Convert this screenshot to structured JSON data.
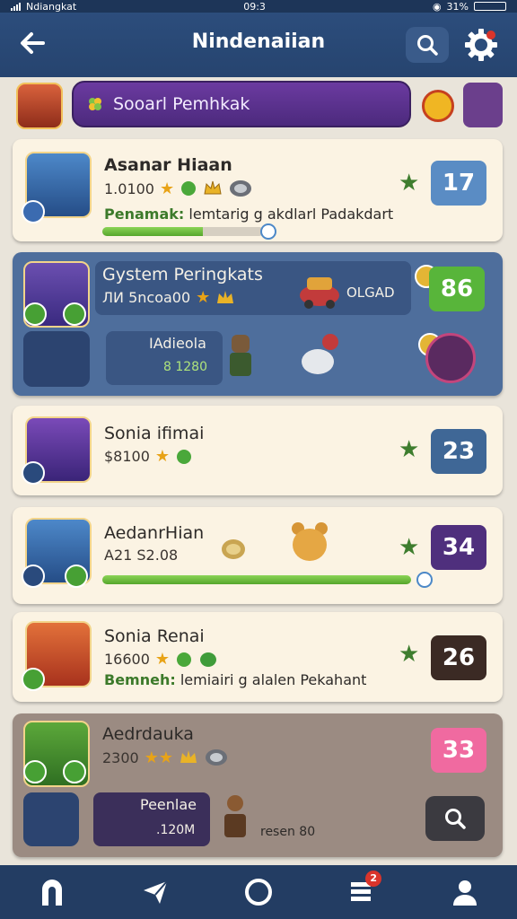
{
  "status_bar": {
    "carrier": "Ndiangkat",
    "time": "09:3",
    "battery": "31%"
  },
  "header": {
    "title": "Nindenaiian"
  },
  "top_bar": {
    "search_label": "Sooarl Pemhkak"
  },
  "cards": [
    {
      "name": "Asanar Hiaan",
      "stats": "1.0100",
      "subtitle_bold": "Penamak:",
      "subtitle_rest": "lemtarig g akdlarl Padakdart",
      "score": "17",
      "progress": 0.62
    },
    {
      "name": "Gystem Peringkats",
      "stats": "ЛИ 5ncoa00",
      "extra_label": "OLGAD",
      "score": "86",
      "second_name": "IAdieola",
      "second_stats": "8 1280"
    },
    {
      "name": "Sonia ifimai",
      "stats": "$8100",
      "score": "23"
    },
    {
      "name": "AedanrHian",
      "stats": "A21 S2.08",
      "score": "34",
      "progress": 1.0
    },
    {
      "name": "Sonia Renai",
      "stats": "16600",
      "subtitle_bold": "Bemneh:",
      "subtitle_rest": "lemiairi g alalen Pekahant",
      "score": "26"
    },
    {
      "name": "Aedrdauka",
      "stats": "2300",
      "score": "33",
      "second_name": "Peenlae",
      "second_stats": ".120M",
      "footer_text": "resen 80"
    }
  ],
  "bottom_nav": {
    "notifications": "2"
  },
  "colors": {
    "score_blue": "#5a8cc4",
    "score_green": "#58b53a",
    "score_dark_blue": "#3f6796",
    "score_purple": "#4f2f7d",
    "score_brown": "#3b2a24",
    "score_pink": "#f06aa0"
  }
}
